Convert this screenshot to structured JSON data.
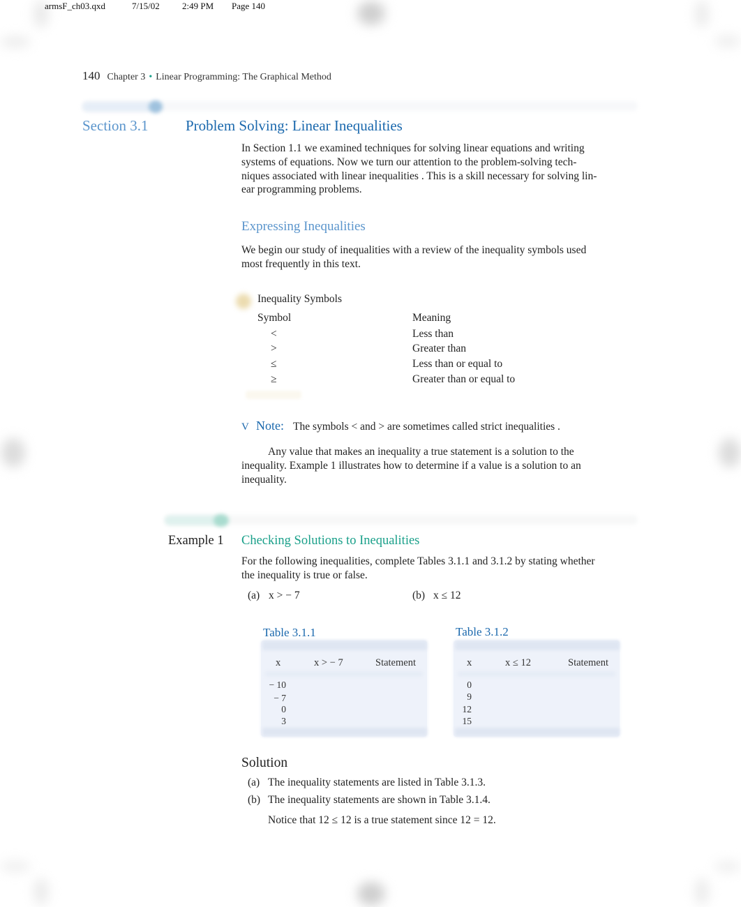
{
  "slug": {
    "filename": "armsF_ch03.qxd",
    "date": "7/15/02",
    "time": "2:49 PM",
    "page": "Page 140"
  },
  "running_head": {
    "page_number": "140",
    "chapter": "Chapter 3",
    "separator": "•",
    "title": "Linear Programming: The Graphical Method"
  },
  "section": {
    "label": "Section 3.1",
    "title": "Problem Solving: Linear Inequalities"
  },
  "intro": {
    "lines": [
      "In Section 1.1 we examined techniques for solving linear equations and writing",
      "systems of equations. Now we turn our attention to the problem-solving tech-",
      "niques associated with  linear inequalities . This is a skill necessary for solving lin-",
      "ear programming problems."
    ]
  },
  "expressing": {
    "heading": "Expressing Inequalities",
    "lines": [
      "We begin our study of  inequalities  with a review of the inequality symbols used",
      "most frequently in this text."
    ]
  },
  "symbols_box": {
    "title": "Inequality Symbols",
    "col_symbol": "Symbol",
    "col_meaning": "Meaning",
    "rows": [
      {
        "symbol": "<",
        "meaning": "Less than"
      },
      {
        "symbol": ">",
        "meaning": "Greater than"
      },
      {
        "symbol": "≤",
        "meaning": "Less than or equal to"
      },
      {
        "symbol": "≥",
        "meaning": "Greater than or equal to"
      }
    ]
  },
  "note": {
    "marker": "V",
    "label": "Note:",
    "text": "The symbols  <  and  >  are sometimes called   strict inequalities  ."
  },
  "solution_para": {
    "lines": [
      "Any value that makes an inequality a true statement is a        solution  to the",
      "inequality. Example 1 illustrates how to determine if a value is a solution to an",
      "inequality."
    ]
  },
  "example": {
    "label": "Example 1",
    "title": "Checking Solutions to Inequalities",
    "lines": [
      "For the following inequalities, complete Tables 3.1.1 and 3.1.2 by stating whether",
      "the inequality is  true  or  false."
    ],
    "part_a_label": "(a)",
    "part_a": "x >  − 7",
    "part_b_label": "(b)",
    "part_b": "x ≤  12"
  },
  "tables": [
    {
      "caption": "Table 3.1.1",
      "headers": [
        "x",
        "x >  − 7",
        "Statement"
      ],
      "x_values": [
        "− 10",
        "− 7",
        "0",
        "3"
      ]
    },
    {
      "caption": "Table 3.1.2",
      "headers": [
        "x",
        "x ≤  12",
        "Statement"
      ],
      "x_values": [
        "0",
        "9",
        "12",
        "15"
      ]
    }
  ],
  "solution": {
    "title": "Solution",
    "a_label": "(a)",
    "a_text": "The inequality statements are listed in Table 3.1.3.",
    "b_label": "(b)",
    "b_text": "The inequality statements are shown in Table 3.1.4.",
    "notice": "Notice that 12   ≤  12 is a true statement since 12    =  12."
  },
  "colors": {
    "section_blue": "#1a68ad",
    "light_blue": "#5b95cc",
    "example_teal": "#1aa08a",
    "table_bg": "#eef2fa"
  }
}
